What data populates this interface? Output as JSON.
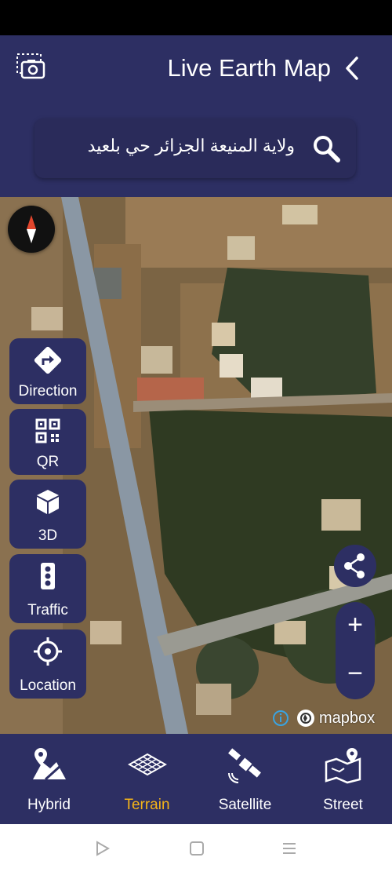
{
  "header": {
    "title": "Live Earth Map",
    "search_text": "ولاية المنيعة الجزائر حي بلعيد"
  },
  "tools": [
    {
      "label": "Direction",
      "icon": "direction-icon"
    },
    {
      "label": "QR",
      "icon": "qr-icon"
    },
    {
      "label": "3D",
      "icon": "cube-3d-icon"
    },
    {
      "label": "Traffic",
      "icon": "traffic-light-icon"
    },
    {
      "label": "Location",
      "icon": "locate-icon"
    }
  ],
  "zoom": {
    "in": "+",
    "out": "−"
  },
  "attribution": "mapbox",
  "bottom_nav": {
    "active": "Terrain",
    "items": [
      {
        "label": "Hybrid",
        "icon": "hybrid-map-icon"
      },
      {
        "label": "Terrain",
        "icon": "terrain-grid-icon"
      },
      {
        "label": "Satellite",
        "icon": "satellite-icon"
      },
      {
        "label": "Street",
        "icon": "street-map-icon"
      }
    ]
  },
  "colors": {
    "primary": "#2d2f63",
    "active_tab": "#f5b418",
    "text": "#ffffff"
  }
}
